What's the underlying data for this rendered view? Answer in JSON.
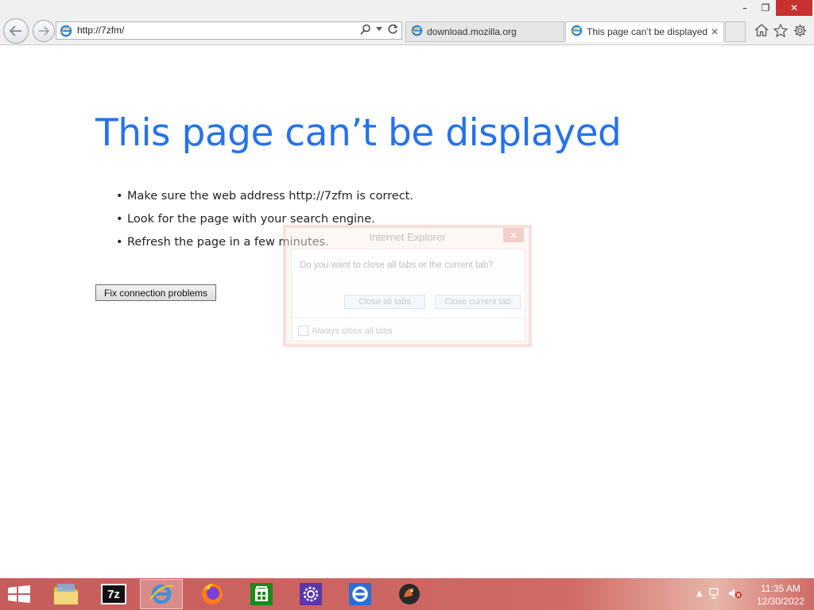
{
  "window": {
    "controls": {
      "minimize": "–",
      "restore": "❐",
      "close": "✕"
    }
  },
  "navbar": {
    "address": {
      "url": "http://7zfm/"
    },
    "tabs": [
      {
        "label": "download.mozilla.org",
        "active": false
      },
      {
        "label": "This page can’t be displayed",
        "active": true,
        "close": "✕"
      }
    ],
    "toolbar_icons": [
      "home-icon",
      "favorites-star-icon",
      "settings-gear-icon"
    ]
  },
  "page": {
    "title": "This page can’t be displayed",
    "suggestions": [
      "Make sure the web address http://7zfm is correct.",
      "Look for the page with your search engine.",
      "Refresh the page in a few minutes."
    ],
    "fix_button": "Fix connection problems"
  },
  "dialog": {
    "title": "Internet Explorer",
    "close": "✕",
    "question": "Do you want to close all tabs or the current tab?",
    "close_all_label": "Close all tabs",
    "close_current_label": "Close current tab",
    "always_label": "Always close all tabs"
  },
  "taskbar": {
    "items": [
      {
        "name": "file-explorer",
        "active": false
      },
      {
        "name": "7-zip",
        "active": false
      },
      {
        "name": "internet-explorer",
        "active": true
      },
      {
        "name": "firefox",
        "active": false
      },
      {
        "name": "store",
        "active": false
      },
      {
        "name": "settings",
        "active": false
      },
      {
        "name": "internet-explorer-2",
        "active": false
      },
      {
        "name": "app",
        "active": false
      }
    ],
    "seven_zip_label": "7z",
    "clock": {
      "time": "11:35 AM",
      "date": "12/30/2022"
    }
  },
  "colors": {
    "title_blue": "#2672ec",
    "taskbar": "#c75c5c",
    "close_red": "#c7312f"
  }
}
